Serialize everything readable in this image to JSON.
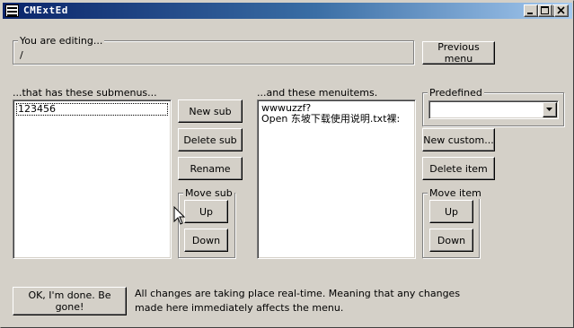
{
  "window": {
    "title": "CMExtEd",
    "controls": {
      "minimize": "minimize",
      "maximize": "maximize",
      "close": "close"
    }
  },
  "editing": {
    "label": "You are editing...",
    "value": "/"
  },
  "previous_menu_button": "Previous menu",
  "submenus": {
    "label": "...that has these submenus...",
    "items": [
      "123456"
    ],
    "selected_index": 0
  },
  "submenu_actions": {
    "new_sub": "New sub",
    "delete_sub": "Delete sub",
    "rename": "Rename",
    "move_sub_label": "Move sub",
    "up": "Up",
    "down": "Down"
  },
  "menuitems": {
    "label": "...and these menuitems.",
    "items": [
      "wwwuzzf?",
      "Open 东坡下载使用说明.txt裸:"
    ]
  },
  "predefined": {
    "label": "Predefined",
    "value": ""
  },
  "item_actions": {
    "new_custom": "New custom...",
    "delete_item": "Delete item",
    "move_item_label": "Move item",
    "up": "Up",
    "down": "Down"
  },
  "footer": {
    "done_button": "OK, I'm done. Be gone!",
    "note_line1": "All changes are taking place real-time. Meaning that any changes",
    "note_line2": "made here immediately affects the menu."
  },
  "icons": [
    "app-icon",
    "minimize-icon",
    "maximize-icon",
    "close-icon",
    "dropdown-arrow-icon",
    "mouse-cursor-icon"
  ]
}
